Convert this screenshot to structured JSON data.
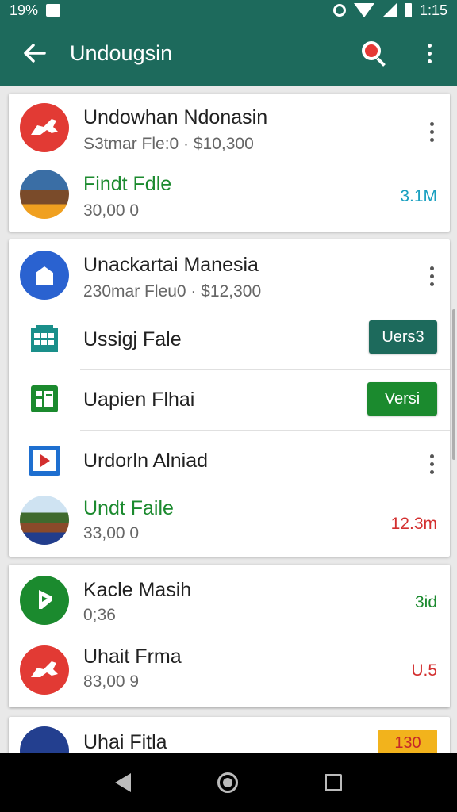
{
  "statusbar": {
    "left_text": "19%",
    "time": "1:15"
  },
  "appbar": {
    "title": "Undougsin"
  },
  "cards": [
    {
      "header": {
        "title": "Undowhan Ndonasin",
        "subtitle": "S3tmar Fle:0 · $10,300"
      },
      "file": {
        "title": "Findt Fdle",
        "subtitle": "30,00 0",
        "meta": "3.1M"
      }
    },
    {
      "header": {
        "title": "Unackartai Manesia",
        "subtitle": "230mar Fleu0 · $12,300"
      },
      "items": [
        {
          "label": "Ussigj Fale",
          "button": "Uers3"
        },
        {
          "label": "Uapien Flhai",
          "button": "Versi"
        },
        {
          "label": "Urdorln Alniad"
        }
      ],
      "file": {
        "title": "Undt Faile",
        "subtitle": "33,00 0",
        "meta": "12.3m"
      }
    },
    {
      "header": {
        "title": "Kacle Masih",
        "subtitle": "0;36",
        "meta": "3id"
      },
      "file": {
        "title": "Uhait Frma",
        "subtitle": "83,00 9",
        "meta": "U.5"
      }
    },
    {
      "header": {
        "title": "Uhai Fitla",
        "meta": "130"
      }
    }
  ],
  "colors": {
    "primary": "#1d6a5c",
    "accent_green": "#1b8a2e",
    "meta_teal": "#1aa0c0",
    "meta_red": "#d32f2f",
    "badge_yellow": "#f2b31c"
  },
  "icons": [
    "back-arrow-icon",
    "search-icon",
    "more-vert-icon",
    "calendar-grid-icon",
    "sheet-icon",
    "video-icon",
    "home-icon",
    "play-badge-icon"
  ]
}
